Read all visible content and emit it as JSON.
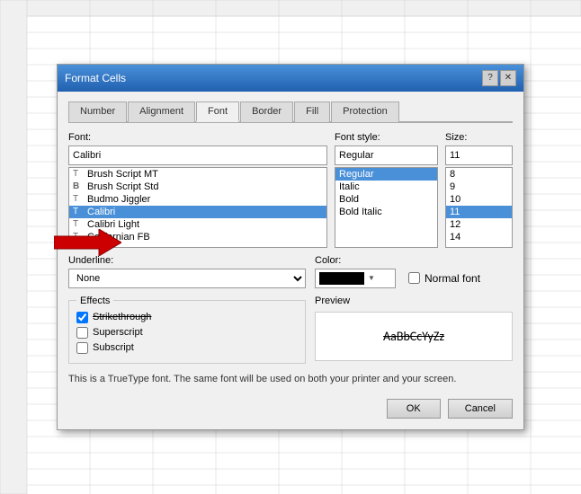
{
  "dialog": {
    "title": "Format Cells",
    "tabs": [
      {
        "label": "Number",
        "id": "number",
        "active": false
      },
      {
        "label": "Alignment",
        "id": "alignment",
        "active": false
      },
      {
        "label": "Font",
        "id": "font",
        "active": true
      },
      {
        "label": "Border",
        "id": "border",
        "active": false
      },
      {
        "label": "Fill",
        "id": "fill",
        "active": false
      },
      {
        "label": "Protection",
        "id": "protection",
        "active": false
      }
    ]
  },
  "font_tab": {
    "font_label": "Font:",
    "font_value": "Calibri",
    "font_list": [
      {
        "name": "Brush Script MT",
        "icon": "T"
      },
      {
        "name": "Brush Script Std",
        "icon": "B"
      },
      {
        "name": "Budmo Jiggler",
        "icon": "T"
      },
      {
        "name": "Calibri",
        "icon": "T",
        "selected": true
      },
      {
        "name": "Calibri Light",
        "icon": "T"
      },
      {
        "name": "Californian FB",
        "icon": "T"
      }
    ],
    "style_label": "Font style:",
    "style_value": "Regular",
    "style_list": [
      {
        "name": "Regular",
        "selected": true
      },
      {
        "name": "Italic"
      },
      {
        "name": "Bold"
      },
      {
        "name": "Bold Italic"
      }
    ],
    "size_label": "Size:",
    "size_value": "11",
    "size_list": [
      {
        "value": "8"
      },
      {
        "value": "9"
      },
      {
        "value": "10"
      },
      {
        "value": "11",
        "selected": true
      },
      {
        "value": "12"
      },
      {
        "value": "14"
      }
    ],
    "underline_label": "Underline:",
    "underline_value": "None",
    "color_label": "Color:",
    "color_value": "Black",
    "normal_font_label": "Normal font",
    "effects": {
      "legend": "Effects",
      "strikethrough_label": "Strikethrough",
      "strikethrough_checked": true,
      "superscript_label": "Superscript",
      "superscript_checked": false,
      "subscript_label": "Subscript",
      "subscript_checked": false
    },
    "preview_label": "Preview",
    "preview_text": "AaBbCcYyZz",
    "info_text": "This is a TrueType font.  The same font will be used on both your printer and your screen.",
    "ok_label": "OK",
    "cancel_label": "Cancel"
  }
}
